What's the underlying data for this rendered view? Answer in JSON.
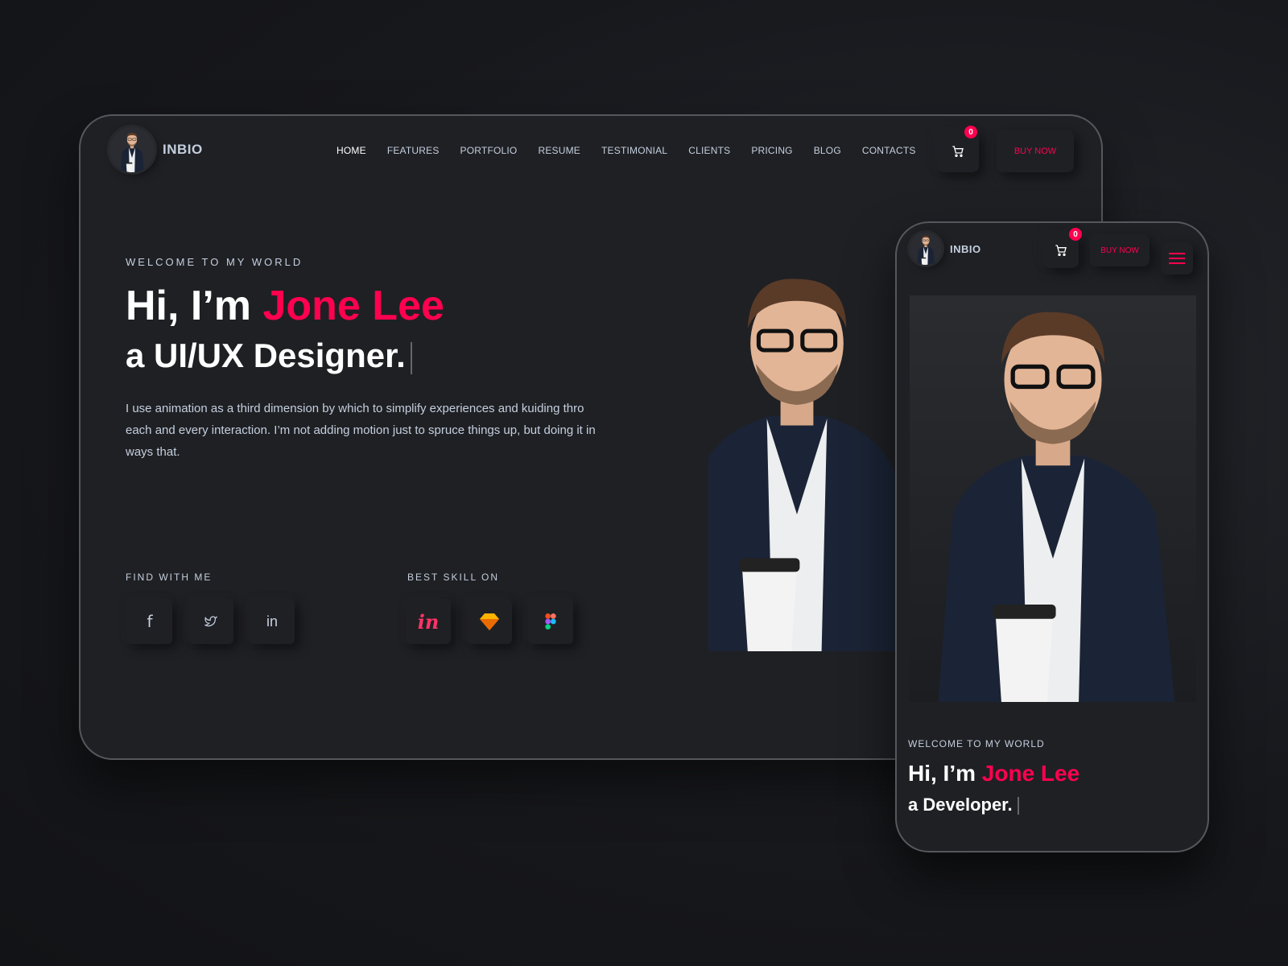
{
  "desktop": {
    "brand": "INBIO",
    "nav": [
      "HOME",
      "FEATURES",
      "PORTFOLIO",
      "RESUME",
      "TESTIMONIAL",
      "CLIENTS",
      "PRICING",
      "BLOG",
      "CONTACTS"
    ],
    "cart_count": "0",
    "buy_now": "BUY NOW",
    "hero": {
      "subtitle": "WELCOME TO MY WORLD",
      "greeting": "Hi, I’m ",
      "name": "Jone Lee",
      "role": "a UI/UX Designer.",
      "description": "I use animation as a third dimension by which to simplify experiences and kuiding thro each and every interaction. I’m not adding motion just to spruce things up, but doing it in ways that."
    },
    "find_with_me": {
      "label": "FIND WITH ME",
      "icons": [
        "facebook-icon",
        "twitter-icon",
        "linkedin-icon"
      ]
    },
    "best_skill_on": {
      "label": "BEST SKILL ON",
      "icons": [
        "invision-icon",
        "sketch-icon",
        "figma-icon"
      ]
    }
  },
  "mobile": {
    "brand": "INBIO",
    "cart_count": "0",
    "buy_now": "BUY NOW",
    "hero": {
      "subtitle": "WELCOME TO MY WORLD",
      "greeting": "Hi, I’m ",
      "name": "Jone Lee",
      "role_prefix": "a ",
      "role": "Developer."
    }
  },
  "colors": {
    "accent": "#ff014f",
    "background": "#1f2024",
    "text": "#c4cfde"
  }
}
